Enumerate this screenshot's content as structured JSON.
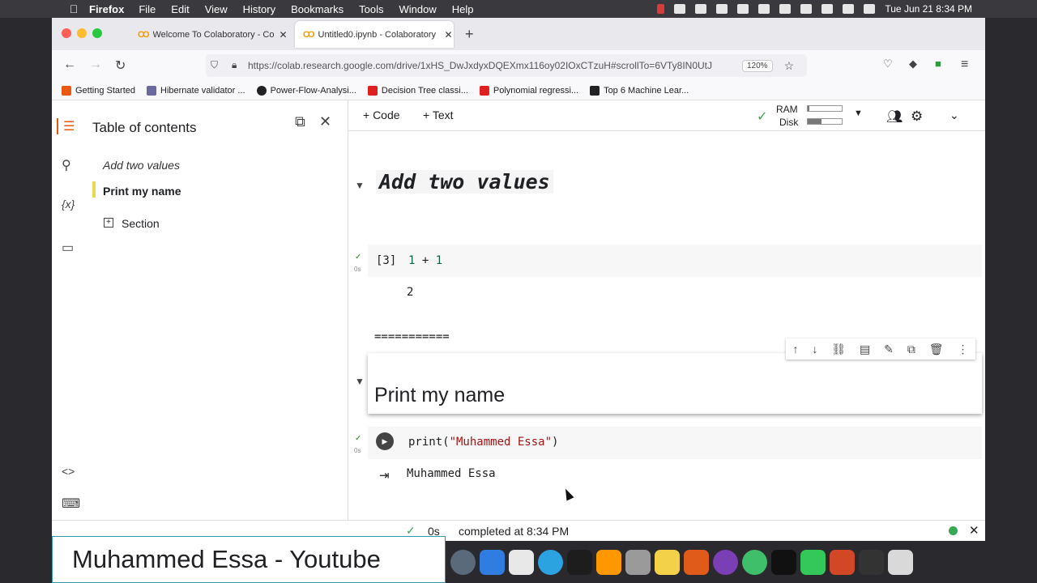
{
  "menubar": {
    "app": "Firefox",
    "items": [
      "File",
      "Edit",
      "View",
      "History",
      "Bookmarks",
      "Tools",
      "Window",
      "Help"
    ],
    "clock": "Tue Jun 21  8:34 PM"
  },
  "browser": {
    "tabs": [
      {
        "label": "Welcome To Colaboratory - Cola",
        "logo": "CO"
      },
      {
        "label": "Untitled0.ipynb - Colaboratory",
        "logo": "CO"
      }
    ],
    "url": "https://colab.research.google.com/drive/1xHS_DwJxdyxDQEXmx116oy02IOxCTzuH#scrollTo=6VTy8IN0UtJ",
    "zoom": "120%",
    "bookmarks": [
      {
        "label": "Getting Started",
        "color": "#e8590c"
      },
      {
        "label": "Hibernate validator ...",
        "color": "#6a6a9e"
      },
      {
        "label": "Power-Flow-Analysi...",
        "color": "#222222"
      },
      {
        "label": "Decision Tree classi...",
        "color": "#e02020"
      },
      {
        "label": "Polynomial regressi...",
        "color": "#e02020"
      },
      {
        "label": "Top 6 Machine Lear...",
        "color": "#222222"
      }
    ]
  },
  "toc": {
    "title": "Table of contents",
    "items": [
      {
        "label": "Add two values"
      },
      {
        "label": "Print my name"
      },
      {
        "label": "Section"
      }
    ]
  },
  "toolbar": {
    "code_label": "+ Code",
    "text_label": "+ Text",
    "ram_label": "RAM",
    "disk_label": "Disk",
    "ram_usage": 0.05,
    "disk_usage": 0.4
  },
  "notebook": {
    "heading1": "Add two values",
    "cell1": {
      "exec": "[3]",
      "time": "0s",
      "tokens": [
        "1",
        " + ",
        "1"
      ],
      "output": "2"
    },
    "separator": "===========",
    "heading2": "Print my name",
    "cell2": {
      "time": "0s",
      "func": "print(",
      "arg": "\"Muhammed Essa\"",
      "close": ")",
      "output": "Muhammed Essa"
    }
  },
  "status": {
    "time": "0s",
    "text": "completed at 8:34 PM"
  },
  "overlay": {
    "text": "Muhammed Essa - Youtube"
  },
  "colors": {
    "accent_orange": "#f29b00",
    "toc_active": "#e8d94a",
    "success_green": "#34a853"
  }
}
